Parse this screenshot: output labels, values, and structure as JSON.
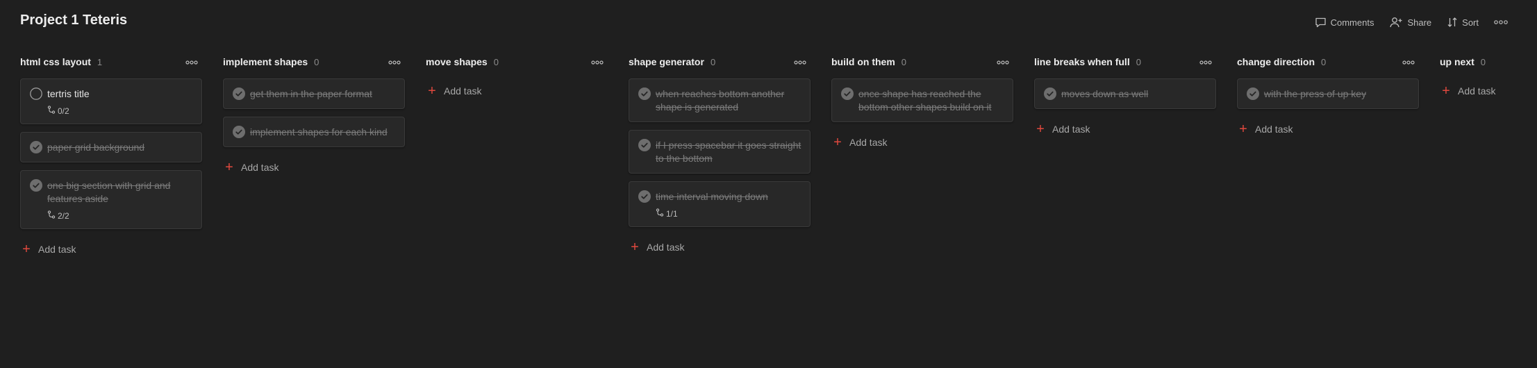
{
  "project": {
    "title": "Project 1 Teteris"
  },
  "toolbar": {
    "comments": "Comments",
    "share": "Share",
    "sort": "Sort"
  },
  "colors": {
    "accent": "#e0483e",
    "background": "#1f1f1f",
    "card": "#282828"
  },
  "add_task_label": "Add task",
  "columns": [
    {
      "title": "html css layout",
      "count": "1",
      "tasks": [
        {
          "text": "tertris title",
          "done": false,
          "sub": "0/2"
        },
        {
          "text": "paper grid background",
          "done": true
        },
        {
          "text": "one big section with grid and features aside",
          "done": true,
          "sub": "2/2"
        }
      ]
    },
    {
      "title": "implement shapes",
      "count": "0",
      "tasks": [
        {
          "text": "get them in the paper format",
          "done": true
        },
        {
          "text": "implement shapes for each kind",
          "done": true
        }
      ]
    },
    {
      "title": "move shapes",
      "count": "0",
      "tasks": []
    },
    {
      "title": "shape generator",
      "count": "0",
      "tasks": [
        {
          "text": "when reaches bottom another shape is generated",
          "done": true
        },
        {
          "text": "if I press spacebar it goes straight to the bottom",
          "done": true
        },
        {
          "text": "time interval moving down",
          "done": true,
          "sub": "1/1"
        }
      ]
    },
    {
      "title": "build on them",
      "count": "0",
      "tasks": [
        {
          "text": "once shape has reached the bottom other shapes build on it",
          "done": true
        }
      ]
    },
    {
      "title": "line breaks when full",
      "count": "0",
      "tasks": [
        {
          "text": "moves down as well",
          "done": true
        }
      ]
    },
    {
      "title": "change direction",
      "count": "0",
      "tasks": [
        {
          "text": "with the press of up key",
          "done": true
        }
      ]
    },
    {
      "title": "up next",
      "count": "0",
      "tasks": []
    }
  ]
}
